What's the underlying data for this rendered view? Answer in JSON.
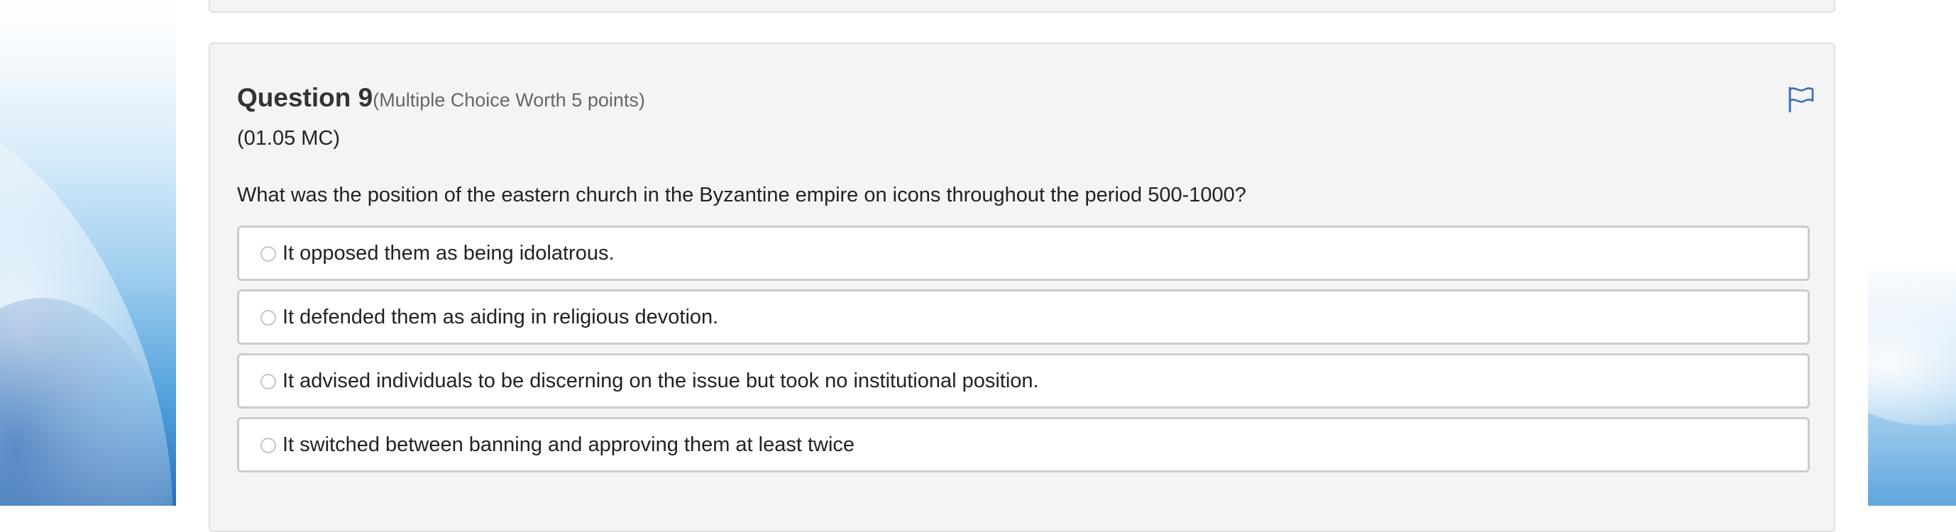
{
  "question": {
    "title": "Question 9",
    "meta": "(Multiple Choice Worth 5 points)",
    "code": "(01.05 MC)",
    "prompt": "What was the position of the eastern church in the Byzantine empire on icons throughout the period 500-1000?",
    "flag_icon": "flag-icon",
    "options": [
      {
        "label": "It opposed them as being idolatrous.",
        "selected": false
      },
      {
        "label": "It defended them as aiding in religious devotion.",
        "selected": false
      },
      {
        "label": "It advised individuals to be discerning on the issue but took no institutional position.",
        "selected": false
      },
      {
        "label": "It switched between banning and approving them at least twice",
        "selected": false
      }
    ]
  },
  "colors": {
    "card_background": "#f4f4f4",
    "card_border": "#e0e0e0",
    "flag_blue": "#3b6fb6",
    "text": "#222222",
    "meta_text": "#666666"
  }
}
